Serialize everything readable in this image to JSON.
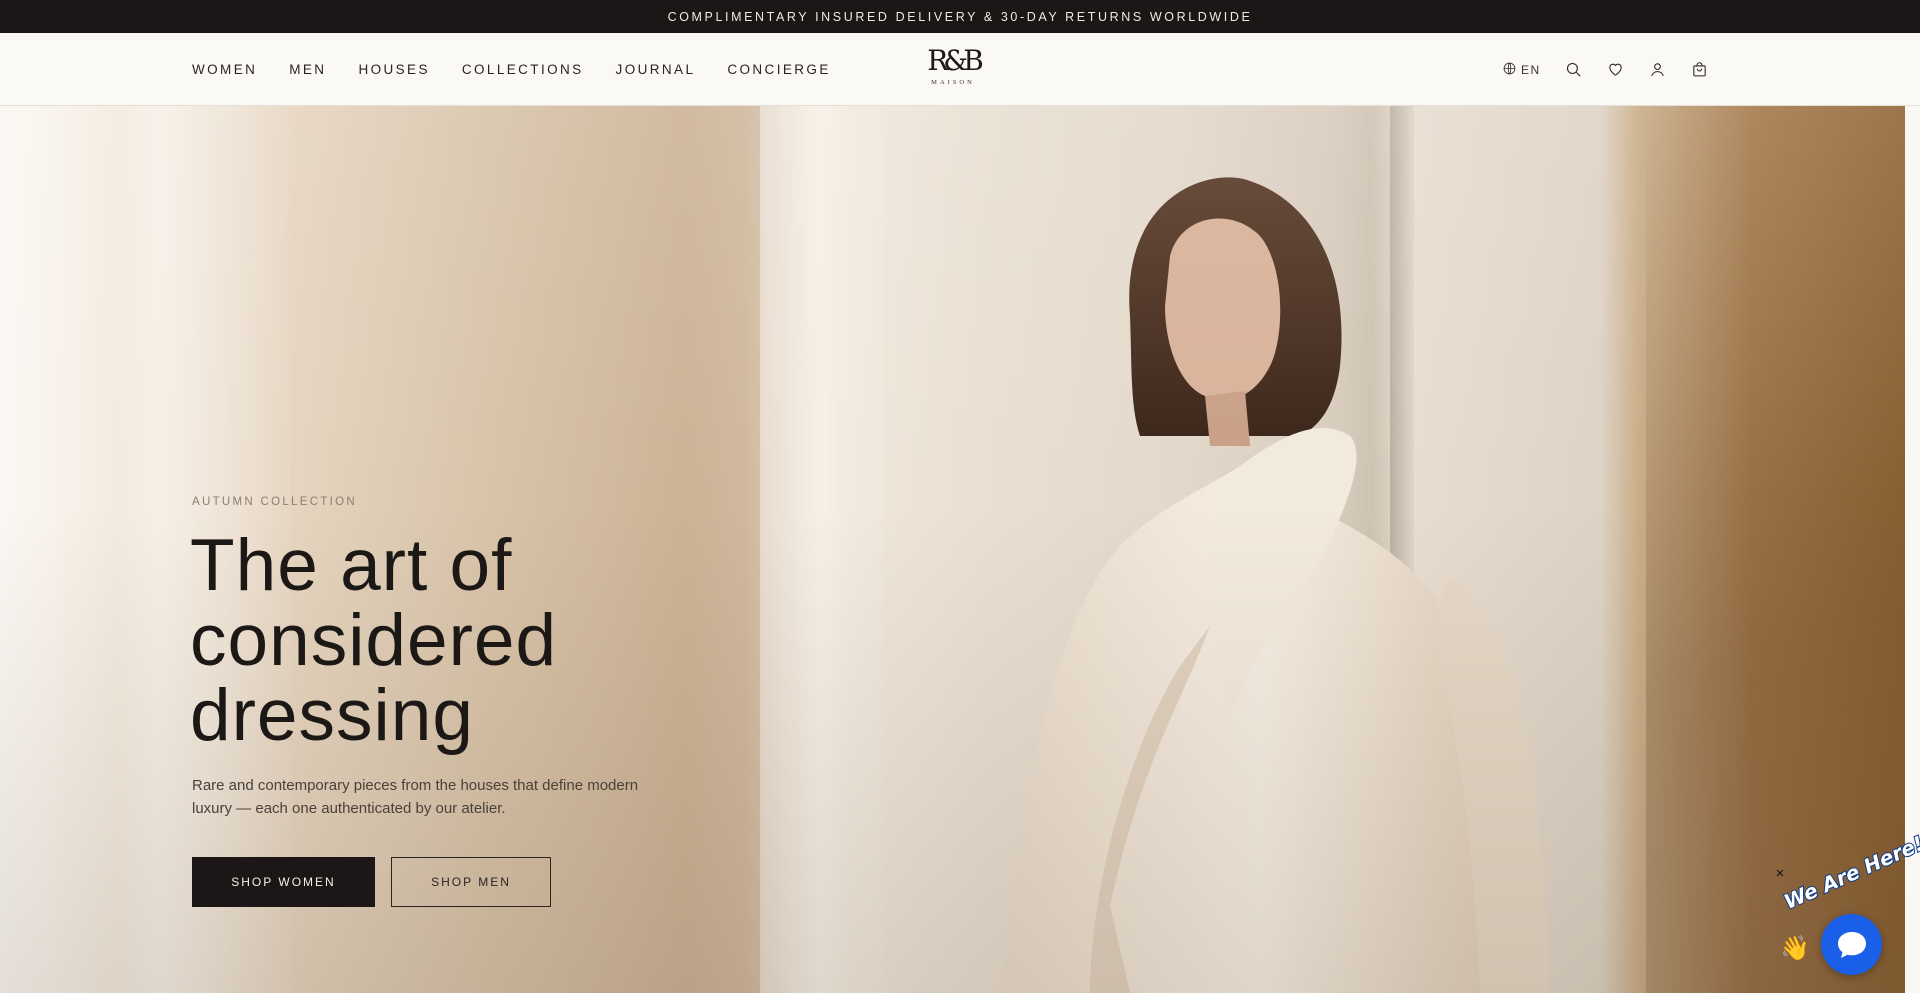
{
  "announcement": {
    "text": "COMPLIMENTARY INSURED DELIVERY & 30-DAY RETURNS WORLDWIDE"
  },
  "header": {
    "nav": [
      {
        "label": "WOMEN"
      },
      {
        "label": "MEN"
      },
      {
        "label": "HOUSES"
      },
      {
        "label": "COLLECTIONS"
      },
      {
        "label": "JOURNAL"
      },
      {
        "label": "CONCIERGE"
      }
    ],
    "logo": {
      "monogram": "R&B",
      "subtitle": "MAISON"
    },
    "language": {
      "label": "EN",
      "icon": "globe-icon"
    },
    "icons": [
      "search-icon",
      "heart-icon",
      "user-icon",
      "bag-icon"
    ]
  },
  "hero": {
    "eyebrow": "AUTUMN COLLECTION",
    "headline_lines": [
      "The art of",
      "considered",
      "dressing"
    ],
    "intro_lines": [
      "Rare and contemporary pieces from the houses that define modern",
      "luxury — each one authenticated by our atelier."
    ],
    "buttons": {
      "primary": "SHOP WOMEN",
      "secondary": "SHOP MEN"
    },
    "image_alt": "Model in a cream wool coat leaning against a marble wall"
  },
  "chat": {
    "tag": "We Are Here!",
    "close": "×",
    "wave": "👋"
  },
  "colors": {
    "announcement_bg": "#1c1716",
    "header_bg": "#faf9f5",
    "primary_button_bg": "#1c1716",
    "chat_blue": "#1a5fe8"
  }
}
